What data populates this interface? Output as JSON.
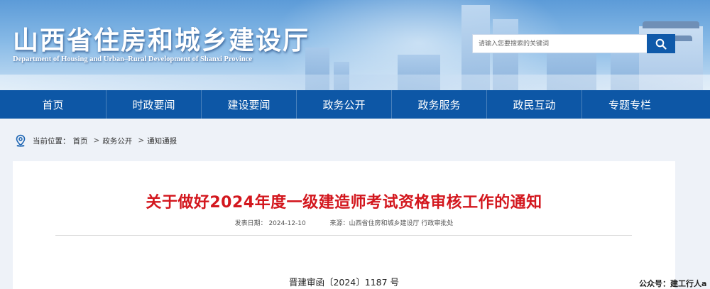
{
  "header": {
    "site_title": "山西省住房和城乡建设厅",
    "site_subtitle": "Department of Housing and Urban–Rural Development of Shanxi Province",
    "search_placeholder": "请输入您要搜索的关键词"
  },
  "nav": {
    "items": [
      "首页",
      "时政要闻",
      "建设要闻",
      "政务公开",
      "政务服务",
      "政民互动",
      "专题专栏"
    ]
  },
  "breadcrumb": {
    "label": "当前位置：",
    "items": [
      "首页",
      "政务公开",
      "通知通报"
    ],
    "separator": ">"
  },
  "article": {
    "title": "关于做好2024年度一级建造师考试资格审核工作的通知",
    "date": "发表日期： 2024-12-10",
    "source": "来源：山西省住房和城乡建设厅 行政审批处",
    "doc_number": "晋建审函〔2024〕1187 号"
  },
  "watermark": "公众号：建工行人a",
  "colors": {
    "nav_bg": "#0d57a6",
    "title_red": "#d3171e",
    "search_button": "#0f5aaa"
  }
}
